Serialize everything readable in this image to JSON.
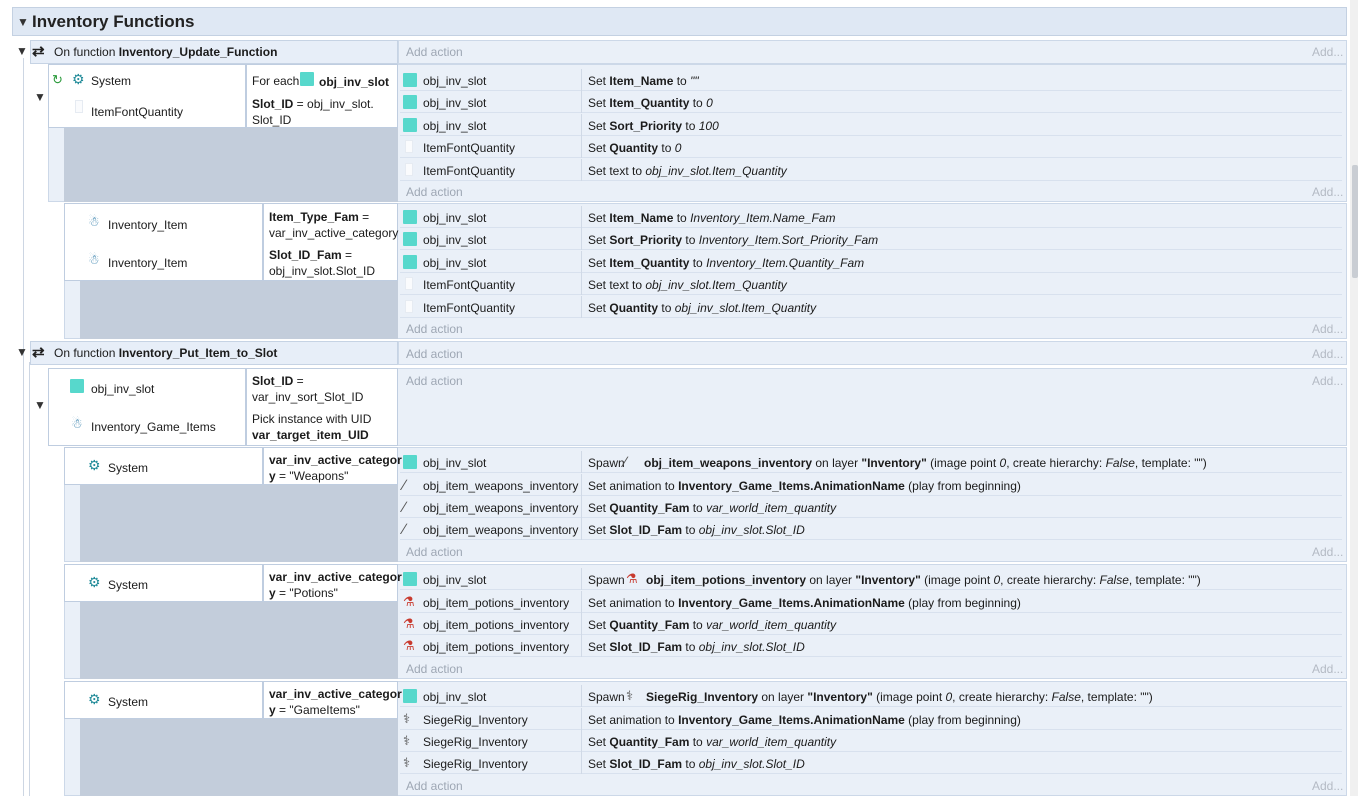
{
  "group": {
    "title": "Inventory Functions"
  },
  "labels": {
    "add_action": "Add action",
    "add": "Add...",
    "system": "System",
    "on_function": "On function"
  },
  "func1": {
    "name": "Inventory_Update_Function",
    "block1": {
      "cond1_obj": "System",
      "cond1_prefix": "For each",
      "cond1_obj2": "obj_inv_slot",
      "cond2_obj": "ItemFontQuantity",
      "cond2_a": "Slot_ID",
      "cond2_b": " = obj_inv_slot.",
      "cond2_c": "Slot_ID",
      "actions": [
        {
          "obj": "obj_inv_slot",
          "v": "Set ",
          "p": "Item_Name",
          "t": " to ",
          "x": "\"\""
        },
        {
          "obj": "obj_inv_slot",
          "v": "Set ",
          "p": "Item_Quantity",
          "t": " to ",
          "x": "0"
        },
        {
          "obj": "obj_inv_slot",
          "v": "Set ",
          "p": "Sort_Priority",
          "t": " to ",
          "x": "100"
        },
        {
          "obj": "ItemFontQuantity",
          "v": "Set ",
          "p": "Quantity",
          "t": " to ",
          "x": "0"
        },
        {
          "obj": "ItemFontQuantity",
          "v": "Set text to ",
          "p": "",
          "t": "",
          "x": "obj_inv_slot.Item_Quantity"
        }
      ]
    },
    "block2": {
      "cond1_obj": "Inventory_Item",
      "cond1_a": "Item_Type_Fam",
      "cond1_b": " =",
      "cond1_c": "var_inv_active_category",
      "cond2_obj": "Inventory_Item",
      "cond2_a": "Slot_ID_Fam",
      "cond2_b": " =",
      "cond2_c": "obj_inv_slot.Slot_ID",
      "actions": [
        {
          "obj": "obj_inv_slot",
          "v": "Set ",
          "p": "Item_Name",
          "t": " to ",
          "x": "Inventory_Item.Name_Fam"
        },
        {
          "obj": "obj_inv_slot",
          "v": "Set ",
          "p": "Sort_Priority",
          "t": " to ",
          "x": "Inventory_Item.Sort_Priority_Fam"
        },
        {
          "obj": "obj_inv_slot",
          "v": "Set ",
          "p": "Item_Quantity",
          "t": " to ",
          "x": "Inventory_Item.Quantity_Fam"
        },
        {
          "obj": "ItemFontQuantity",
          "v": "Set text to ",
          "p": "",
          "t": "",
          "x": "obj_inv_slot.Item_Quantity"
        },
        {
          "obj": "ItemFontQuantity",
          "v": "Set ",
          "p": "Quantity",
          "t": " to ",
          "x": "obj_inv_slot.Item_Quantity"
        }
      ]
    }
  },
  "func2": {
    "name": "Inventory_Put_Item_to_Slot",
    "block1": {
      "cond1_obj": "obj_inv_slot",
      "cond1_a": "Slot_ID",
      "cond1_b": " =",
      "cond1_c": "var_inv_sort_Slot_ID",
      "cond2_obj": "Inventory_Game_Items",
      "cond2_a": "Pick instance with UID",
      "cond2_b": "var_target_item_UID"
    },
    "subs": [
      {
        "cond_obj": "System",
        "cond_a": "var_inv_active_categor",
        "cond_b": "y",
        "cond_c": " = \"Weapons\"",
        "spawn_obj": "obj_inv_slot",
        "spawn": {
          "v": "Spawn ",
          "obj": "obj_item_weapons_inventory",
          "m": " on layer ",
          "layer": "\"Inventory\"",
          "r1": " (image point ",
          "ip": "0",
          "r2": ", create hierarchy: ",
          "ch": "False",
          "r3": ", template: \"\")"
        },
        "item_obj": "obj_item_weapons_inventory",
        "icon": "sword-icon"
      },
      {
        "cond_obj": "System",
        "cond_a": "var_inv_active_categor",
        "cond_b": "y",
        "cond_c": " = \"Potions\"",
        "spawn_obj": "obj_inv_slot",
        "spawn": {
          "v": "Spawn ",
          "obj": "obj_item_potions_inventory",
          "m": " on layer ",
          "layer": "\"Inventory\"",
          "r1": " (image point ",
          "ip": "0",
          "r2": ", create hierarchy: ",
          "ch": "False",
          "r3": ", template: \"\")"
        },
        "item_obj": "obj_item_potions_inventory",
        "icon": "potion-icon"
      },
      {
        "cond_obj": "System",
        "cond_a": "var_inv_active_categor",
        "cond_b": "y",
        "cond_c": " = \"GameItems\"",
        "spawn_obj": "obj_inv_slot",
        "spawn": {
          "v": "Spawn ",
          "obj": "SiegeRig_Inventory",
          "m": " on layer ",
          "layer": "\"Inventory\"",
          "r1": " (image point ",
          "ip": "0",
          "r2": ", create hierarchy: ",
          "ch": "False",
          "r3": ", template: \"\")"
        },
        "item_obj": "SiegeRig_Inventory",
        "icon": "siege-rig-icon"
      }
    ],
    "common_actions": {
      "anim_v": "Set animation to ",
      "anim_b": "Inventory_Game_Items.AnimationName",
      "anim_r": " (play from beginning)",
      "qty_v": "Set ",
      "qty_b": "Quantity_Fam",
      "qty_t": " to ",
      "qty_x": "var_world_item_quantity",
      "slot_v": "Set ",
      "slot_b": "Slot_ID_Fam",
      "slot_t": " to ",
      "slot_x": "obj_inv_slot.Slot_ID"
    }
  },
  "colors": {
    "header": "#dfe8f4",
    "panel": "#eaf0f8",
    "gray": "#c3cddb",
    "sprite": "#57d8cc",
    "gear": "#1f8a98"
  }
}
